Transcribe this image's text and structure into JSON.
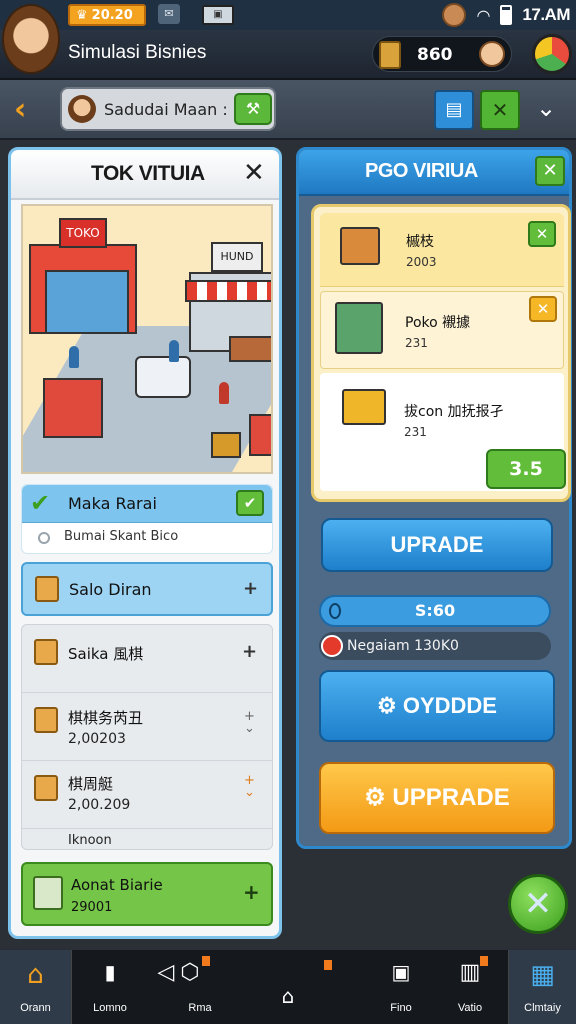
{
  "status_bar": {
    "coins": "20.20",
    "time": "17.AM"
  },
  "header": {
    "title": "Simulasi Bisnies",
    "money": "860"
  },
  "nav": {
    "search_label": "Sadudai Maan :"
  },
  "left_panel": {
    "title": "TOK VITUIA",
    "scene_sign_1": "TOKO",
    "scene_sign_2": "HUND",
    "task": {
      "name": "Maka Rarai",
      "sub": "Bumai Skant Bico"
    },
    "item_blue": "Salo Diran",
    "inventory": [
      {
        "name": "Saika 風棋",
        "value": ""
      },
      {
        "name": "棋棋务芮丑",
        "value": "2,00203"
      },
      {
        "name": "棋周艇",
        "value": "2,00.209"
      }
    ],
    "inventory_footer": "Iknoon",
    "green_item": {
      "name": "Aonat Biarie",
      "value": "29001"
    }
  },
  "right_panel": {
    "title": "PGO VIRIUA",
    "offers": [
      {
        "name": "槭枝",
        "value": "2003"
      },
      {
        "name": "Poko 襯據",
        "value": "231"
      },
      {
        "name": "拔con 加抚报孑",
        "value": "231",
        "price": "3.5"
      }
    ],
    "upgrade_label": "UPRADE",
    "progress_label": "S:60",
    "info_line": "Negaiam 130K0",
    "btn_blue_2": "OYDDDE",
    "btn_orange": "UPPRADE"
  },
  "bottom_nav": [
    {
      "label": "Orann",
      "icon": "home-icon"
    },
    {
      "label": "Lomno",
      "icon": "phone-icon"
    },
    {
      "label": "Rma",
      "icon": "box-icon"
    },
    {
      "label": "",
      "icon": "house-outline-icon"
    },
    {
      "label": "Fino",
      "icon": "screen-icon"
    },
    {
      "label": "Vatio",
      "icon": "chart-icon"
    },
    {
      "label": "Clmtaiy",
      "icon": "grid-icon"
    }
  ],
  "colors": {
    "accent_blue": "#2d89cc",
    "accent_green": "#5cb83a",
    "accent_orange": "#f39a15"
  }
}
